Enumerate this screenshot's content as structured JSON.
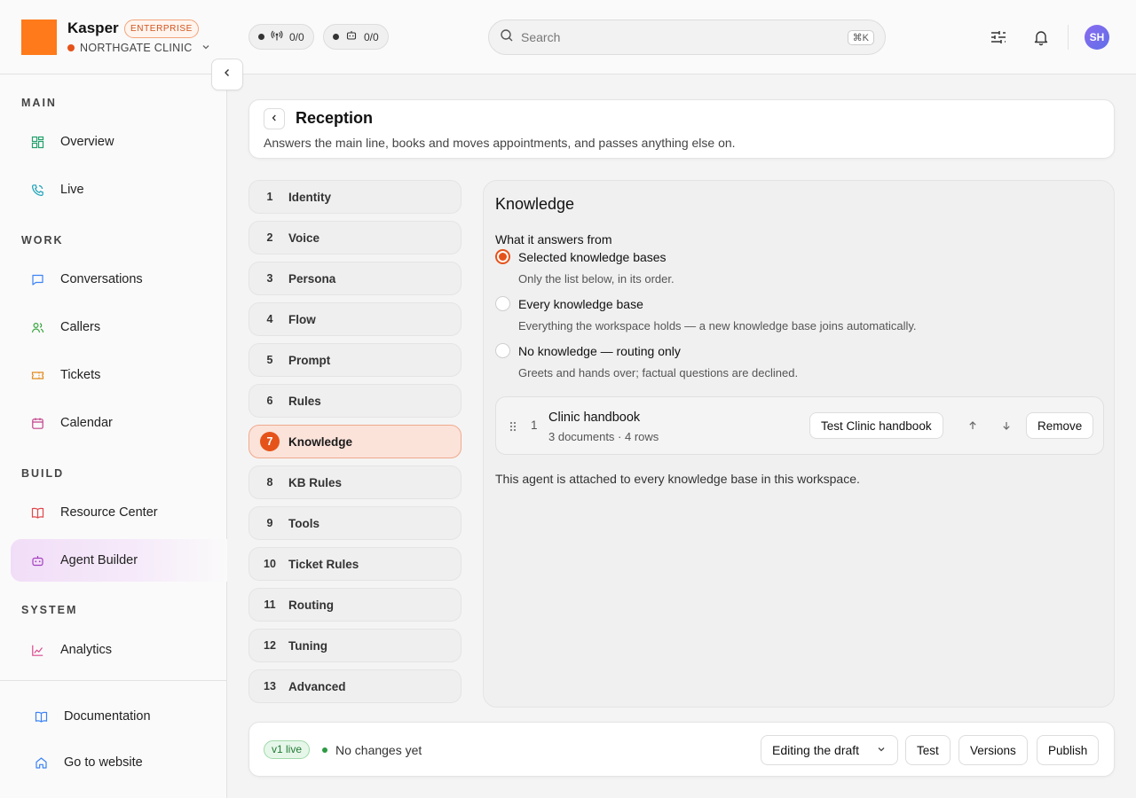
{
  "app": {
    "brand": "Kasper",
    "plan_badge": "ENTERPRISE",
    "workspace": "NORTHGATE CLINIC",
    "brand_color": "#ff7a1a",
    "accent_color": "#e5531a"
  },
  "topbar": {
    "calls_counter": "0/0",
    "bots_counter": "0/0",
    "search_placeholder": "Search",
    "search_shortcut": "⌘K",
    "avatar_initials": "SH"
  },
  "sidebar": {
    "sections": {
      "main": "MAIN",
      "work": "WORK",
      "build": "BUILD",
      "system": "SYSTEM"
    },
    "items": {
      "overview": "Overview",
      "live": "Live",
      "conversations": "Conversations",
      "callers": "Callers",
      "tickets": "Tickets",
      "calendar": "Calendar",
      "resource_center": "Resource Center",
      "agent_builder": "Agent Builder",
      "analytics": "Analytics",
      "documentation": "Documentation",
      "go_to_website": "Go to website"
    },
    "active": "agent_builder"
  },
  "agent": {
    "name": "Reception",
    "description": "Answers the main line, books and moves appointments, and passes anything else on."
  },
  "steps": [
    {
      "num": "1",
      "label": "Identity"
    },
    {
      "num": "2",
      "label": "Voice"
    },
    {
      "num": "3",
      "label": "Persona"
    },
    {
      "num": "4",
      "label": "Flow"
    },
    {
      "num": "5",
      "label": "Prompt"
    },
    {
      "num": "6",
      "label": "Rules"
    },
    {
      "num": "7",
      "label": "Knowledge"
    },
    {
      "num": "8",
      "label": "KB Rules"
    },
    {
      "num": "9",
      "label": "Tools"
    },
    {
      "num": "10",
      "label": "Ticket Rules"
    },
    {
      "num": "11",
      "label": "Routing"
    },
    {
      "num": "12",
      "label": "Tuning"
    },
    {
      "num": "13",
      "label": "Advanced"
    }
  ],
  "knowledge": {
    "title": "Knowledge",
    "field_label": "What it answers from",
    "options": [
      {
        "label": "Selected knowledge bases",
        "help": "Only the list below, in its order.",
        "selected": true
      },
      {
        "label": "Every knowledge base",
        "help": "Everything the workspace holds — a new knowledge base joins automatically.",
        "selected": false
      },
      {
        "label": "No knowledge — routing only",
        "help": "Greets and hands over; factual questions are declined.",
        "selected": false
      }
    ],
    "kb_list": [
      {
        "index": "1",
        "name": "Clinic handbook",
        "meta": "3 documents · 4 rows",
        "test_label": "Test Clinic handbook",
        "remove_label": "Remove"
      }
    ],
    "attached_note": "This agent is attached to every knowledge base in this workspace."
  },
  "footer": {
    "version_badge": "v1 live",
    "status": "No changes yet",
    "mode_select": "Editing the draft",
    "test_label": "Test",
    "versions_label": "Versions",
    "publish_label": "Publish"
  }
}
